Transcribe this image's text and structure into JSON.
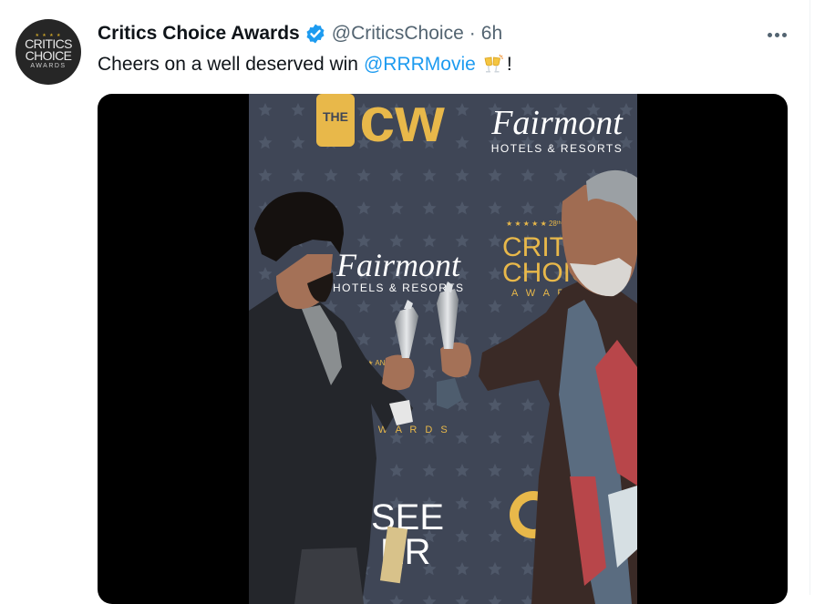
{
  "tweet": {
    "avatar": {
      "stars": "★ ★ ★ ★",
      "line1": "CRITICS",
      "line2": "CHOICE",
      "line3": "AWARDS"
    },
    "display_name": "Critics Choice Awards",
    "verified_icon": "verified-badge-icon",
    "handle": "@CriticsChoice",
    "separator": "·",
    "time": "6h",
    "more_icon": "more-horizontal-icon",
    "text_before": "Cheers on a well deserved win",
    "mention": "@RRRMovie",
    "emoji": "clinking-glasses-emoji",
    "text_after": "!"
  },
  "media": {
    "type": "video-frame",
    "backdrop_text": {
      "cw_small": "THE",
      "cw_big": "cw",
      "fairmont": "Fairmont",
      "fairmont_sub": "HOTELS & RESORTS",
      "fairmont_mid": "Fairmont",
      "fairmont_mid_sub": "HOTELS & RESORTS",
      "critics_stars": "★ ★ ★ ★ ★ 28ᵗʰ AN",
      "critics_line1": "CRITIC",
      "critics_line2": "CHOIC",
      "critics_line3": "A W A R",
      "center_annual": "★ ★ ANNUAL",
      "center_awards": "A W A R D S",
      "see_line1": "SEE",
      "see_line2": "ER"
    },
    "colors": {
      "backdrop": "#3f4656",
      "gold": "#e8b84a"
    }
  }
}
